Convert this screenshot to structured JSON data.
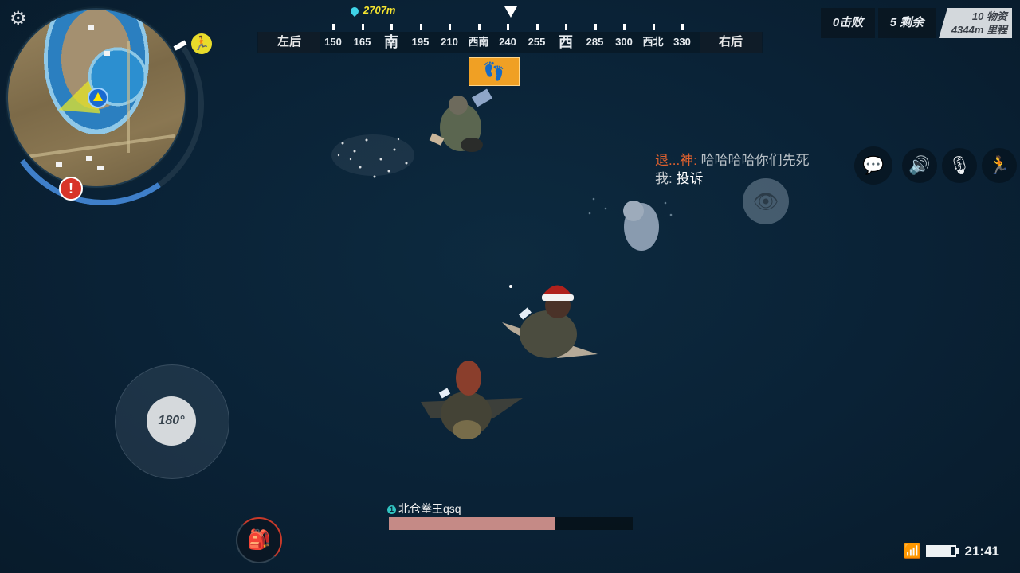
{
  "minimap": {
    "warning": "!"
  },
  "compass": {
    "left_label": "左后",
    "right_label": "右后",
    "ticks": [
      "150",
      "165",
      "南",
      "195",
      "210",
      "西南",
      "240",
      "255",
      "西",
      "285",
      "300",
      "西北",
      "330"
    ],
    "marker_distance": "2707m"
  },
  "stats": {
    "kills_label": "0击败",
    "alive_label": "5 剩余",
    "items_count": "10 物资",
    "distance": "4344m 里程"
  },
  "chat": {
    "line1_name": "退...神:",
    "line1_msg": "哈哈哈哈你们先死",
    "line2_name": "我:",
    "line2_msg": "投诉"
  },
  "controls": {
    "joystick_label": "180°"
  },
  "teammate": {
    "number": "1",
    "name": "北仓拳王qsq",
    "health_fraction": 0.68
  },
  "status_bar": {
    "time": "21:41",
    "battery_fraction": 0.85
  },
  "colors": {
    "background": "#0a2236",
    "enemy_chat": "#e0612e",
    "footstep_alert": "#f0a024",
    "teammate_health": "#c58a86",
    "zone_ring": "#3f7fc9"
  },
  "icons": [
    "settings-icon",
    "run-icon",
    "warning-icon",
    "footstep-icon",
    "chat-icon",
    "speaker-icon",
    "mic-icon",
    "sprint-icon",
    "eye-icon",
    "backpack-icon",
    "wifi-icon",
    "battery-icon"
  ]
}
